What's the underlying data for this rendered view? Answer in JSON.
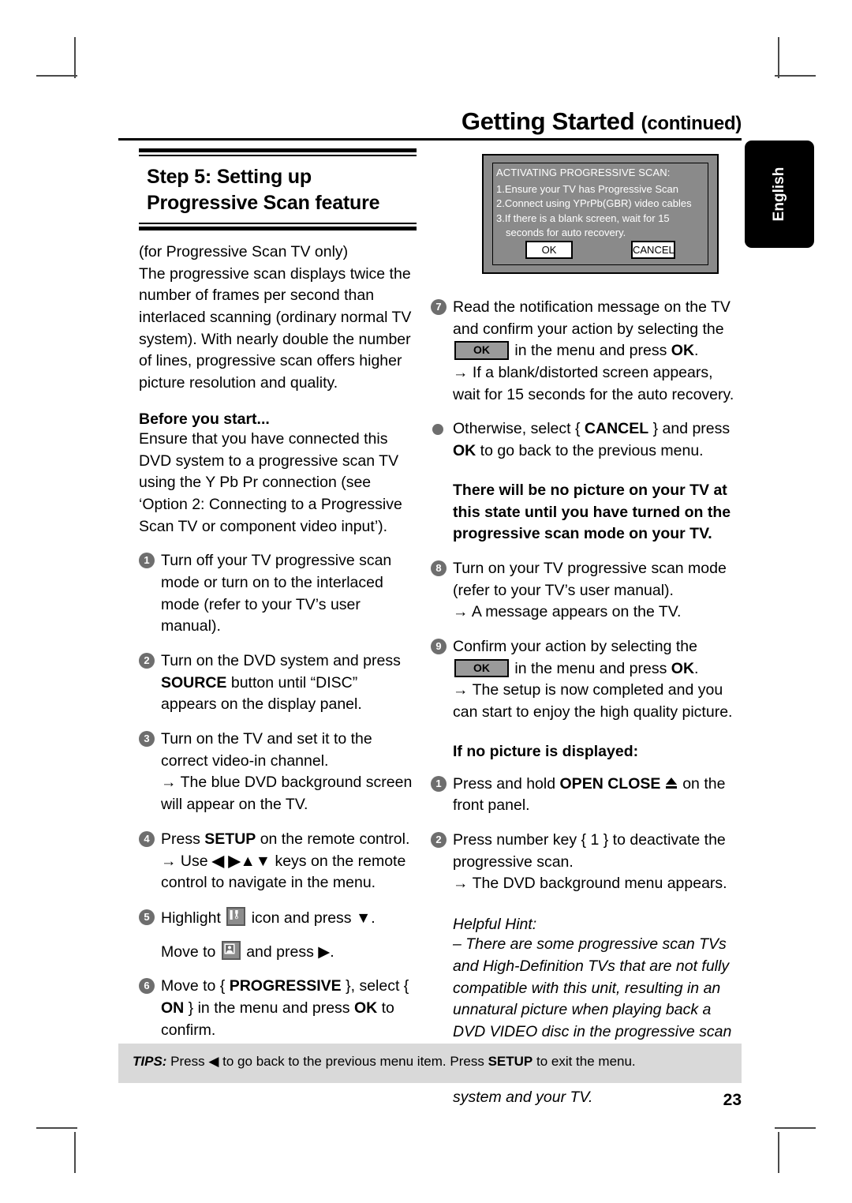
{
  "header": {
    "title": "Getting Started",
    "continued": "(continued)"
  },
  "language_tab": {
    "label": "English"
  },
  "section": {
    "title_line1": "Step 5:  Setting up",
    "title_line2": "Progressive Scan feature"
  },
  "left_column": {
    "intro_paren": "(for Progressive Scan TV only)",
    "intro_body": "The progressive scan displays twice the number of frames per second than interlaced scanning (ordinary normal TV system). With nearly double the number of lines, progressive scan offers higher picture resolution and quality.",
    "before_you_start_heading": "Before you start...",
    "before_you_start_body": "Ensure that you have connected this DVD system to a progressive scan TV using the Y Pb Pr connection (see ‘Option 2: Connecting to a Progressive Scan TV or component video input’).",
    "steps": [
      {
        "num": "1",
        "text": "Turn off your TV progressive scan mode or turn on to the interlaced mode (refer to your TV’s user manual)."
      },
      {
        "num": "2",
        "text_before": "Turn on the DVD system and press ",
        "bold": "SOURCE",
        "text_after": " button until “DISC” appears on the display panel."
      },
      {
        "num": "3",
        "text": "Turn on the TV and set it to the correct video-in channel.",
        "result": "The blue DVD background screen will appear on the TV."
      },
      {
        "num": "4",
        "text_before": "Press ",
        "bold": "SETUP",
        "text_after": " on the remote control.",
        "result_before": "Use ",
        "result_keys": "◀ ▶▲▼",
        "result_after": " keys on the remote control to navigate in the menu."
      },
      {
        "num": "5",
        "line1_before": "Highlight ",
        "line1_icon": "tools-icon",
        "line1_after": " icon and press ▼.",
        "line2_before": "Move to ",
        "line2_icon": "preferences-person-icon",
        "line2_after": " and press ▶."
      },
      {
        "num": "6",
        "text_before": "Move to { ",
        "bold1": "PROGRESSIVE",
        "text_mid": " }, select { ",
        "bold2": "ON",
        "text_mid2": " } in the menu and press ",
        "bold3": "OK",
        "text_after": " to confirm."
      }
    ]
  },
  "tv_screen": {
    "heading": "ACTIVATING PROGRESSIVE SCAN:",
    "lines": [
      "1.Ensure your TV has Progressive Scan",
      "2.Connect using YPrPb(GBR) video cables",
      "3.If there is a blank screen, wait for 15"
    ],
    "line_indent": "seconds for auto recovery.",
    "ok_button": "OK",
    "cancel_button": "CANCEL"
  },
  "right_column": {
    "steps": [
      {
        "num": "7",
        "text_before": "Read the notification message on the TV and confirm your action by selecting the ",
        "badge": "OK",
        "text_mid": " in the menu and press ",
        "bold": "OK",
        "text_after": ".",
        "result": "If a blank/distorted screen appears, wait for 15 seconds for the auto recovery."
      }
    ],
    "bullet_item": {
      "text_before": "Otherwise, select { ",
      "bold1": "CANCEL",
      "text_mid": " } and press ",
      "bold2": "OK",
      "text_after": " to go back to the previous menu."
    },
    "callout": "There will be no picture on your TV at this state until you have turned on the progressive scan mode on your TV.",
    "step8": {
      "num": "8",
      "text": "Turn on your TV progressive scan mode (refer to your TV’s user manual).",
      "result": "A message appears on the TV."
    },
    "step9": {
      "num": "9",
      "text_before": "Confirm your action by selecting the ",
      "badge": "OK",
      "text_mid": " in the menu and press ",
      "bold": "OK",
      "text_after": ".",
      "result": "The setup is now completed and you can start to enjoy the high quality picture."
    },
    "no_picture_heading": "If no picture is displayed:",
    "no_picture_steps": [
      {
        "num": "1",
        "text_before": "Press and hold ",
        "bold": "OPEN CLOSE",
        "icon": "eject-icon",
        "text_after": " on the front panel."
      },
      {
        "num": "2",
        "text": "Press number key { 1 } to deactivate the progressive scan.",
        "result": "The DVD background menu appears."
      }
    ],
    "hint_heading": "Helpful Hint:",
    "hint_body": "– There are some progressive scan TVs and High-Definition TVs that are not fully compatible with this unit, resulting in an unnatural picture when playing back a DVD VIDEO disc in the progressive scan mode. In this case, turn off the progressive scan feature on both the DVD system and your TV."
  },
  "footer": {
    "tips_label": "TIPS:",
    "tips_before": " Press ",
    "tips_arrow": "◀",
    "tips_mid": " to go back to the previous menu item.  Press ",
    "tips_bold": "SETUP",
    "tips_after": " to exit the menu.",
    "page_number": "23"
  }
}
